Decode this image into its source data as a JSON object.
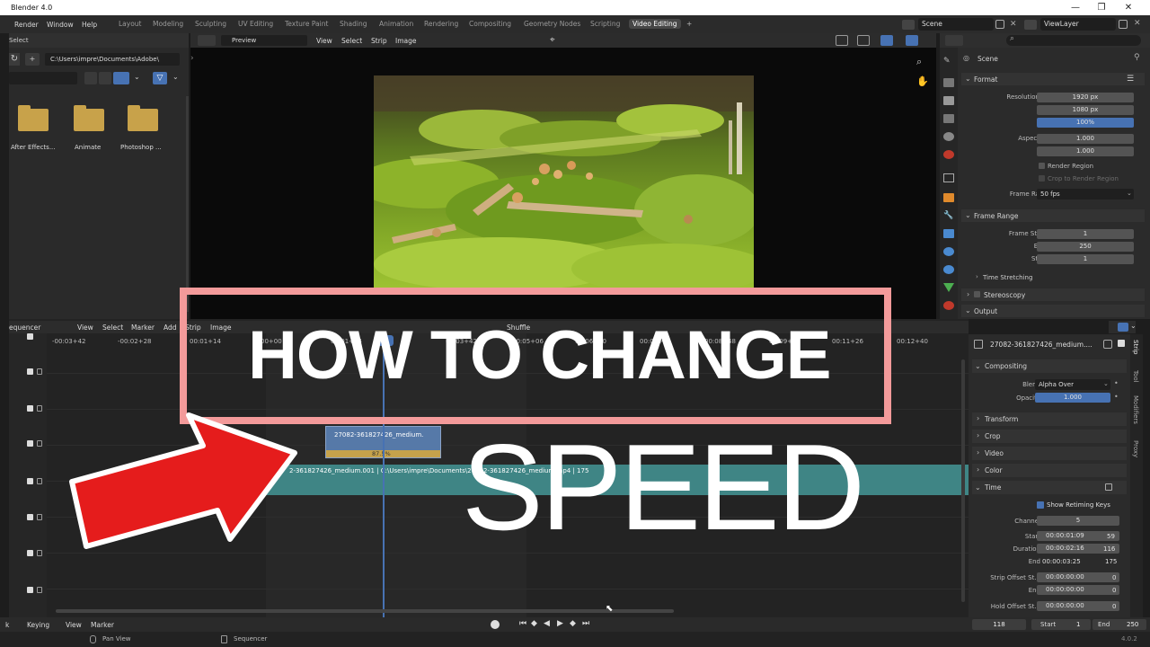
{
  "titlebar": {
    "title": "Blender 4.0",
    "min": "—",
    "max": "❐",
    "close": "✕"
  },
  "topmenu": {
    "items": [
      "Render",
      "Window",
      "Help"
    ]
  },
  "workspaces": [
    "Layout",
    "Modeling",
    "Sculpting",
    "UV Editing",
    "Texture Paint",
    "Shading",
    "Animation",
    "Rendering",
    "Compositing",
    "Geometry Nodes",
    "Scripting",
    "Video Editing"
  ],
  "active_workspace": "Video Editing",
  "add_tab": "+",
  "scene": {
    "name": "Scene",
    "view_layer": "ViewLayer"
  },
  "filebrowser": {
    "header_label": "Select",
    "path": "C:\\Users\\impre\\Documents\\Adobe\\",
    "folders": [
      "After Effects...",
      "Animate",
      "Photoshop ..."
    ]
  },
  "preview": {
    "mode": "Preview",
    "menu": [
      "View",
      "Select",
      "Strip",
      "Image"
    ]
  },
  "properties": {
    "search_placeholder": "",
    "scene_label": "Scene",
    "format_title": "Format",
    "res_x_label": "Resolution X",
    "res_x": "1920 px",
    "res_y_label": "Y",
    "res_y": "1080 px",
    "pct_label": "%",
    "pct": "100%",
    "aspect_x_label": "Aspect X",
    "aspect_x": "1.000",
    "aspect_y_label": "Y",
    "aspect_y": "1.000",
    "render_region": "Render Region",
    "crop_region": "Crop to Render Region",
    "frame_rate_label": "Frame Rate",
    "frame_rate": "50 fps",
    "frame_range_title": "Frame Range",
    "frame_start_label": "Frame Start",
    "frame_start": "1",
    "end_label": "End",
    "end": "250",
    "step_label": "Step",
    "step": "1",
    "time_stretching": "Time Stretching",
    "stereoscopy": "Stereoscopy",
    "output": "Output"
  },
  "sequencer": {
    "editor": "equencer",
    "menu": [
      "View",
      "Select",
      "Marker",
      "Add",
      "Strip",
      "Image"
    ],
    "shuffle": "Shuffle",
    "ticks": [
      "-00:03+42",
      "-00:02+28",
      "00:01+14",
      "00+00",
      "00:01+14",
      "00:02+28",
      "00:03+42",
      "00:05+06",
      "00:06+20",
      "00:07+34",
      "00:08+48",
      "00:09+12",
      "00:11+26",
      "00:12+40"
    ],
    "playhead_label": "28",
    "strip_small_name": "27082-361827426_medium.",
    "strip_small_speed": "87.5%",
    "strip_long_text": "2-361827426_medium.001 | C:\\Users\\impre\\Documents\\27082-361827426_medium.mp4 | 175"
  },
  "strip_panel": {
    "strip_name": "27082-361827426_medium....",
    "compositing": "Compositing",
    "blend_label": "Blend",
    "blend": "Alpha Over",
    "opacity_label": "Opacity",
    "opacity": "1.000",
    "transform": "Transform",
    "crop": "Crop",
    "video": "Video",
    "color": "Color",
    "time": "Time",
    "show_retiming": "Show Retiming Keys",
    "channel_label": "Channel",
    "channel": "5",
    "start_label": "Start",
    "start_tc": "00:00:01:09",
    "start_fr": "59",
    "duration_label": "Duration",
    "duration_tc": "00:00:02:16",
    "duration_fr": "116",
    "end_label": "End",
    "end_tc": "00:00:03:25",
    "end_fr": "175",
    "offset_start_label": "Strip Offset St...",
    "offset_start_tc": "00:00:00:00",
    "offset_start_fr": "0",
    "offset_end_label": "End",
    "offset_end_tc": "00:00:00:00",
    "offset_end_fr": "0",
    "hold_label": "Hold Offset St...",
    "hold_tc": "00:00:00:00",
    "hold_fr": "0",
    "vtabs": [
      "Strip",
      "Tool",
      "Modifiers",
      "Proxy"
    ]
  },
  "timeline": {
    "keying": "Keying",
    "view": "View",
    "marker": "Marker",
    "k": "k",
    "current_frame": "118",
    "start_label": "Start",
    "start": "1",
    "end_label": "End",
    "end": "250"
  },
  "statusbar": {
    "pan_view": "Pan View",
    "sequencer": "Sequencer",
    "version": "4.0.2"
  },
  "overlay": {
    "headline": "HOW TO CHANGE",
    "subline": "SPEED"
  }
}
